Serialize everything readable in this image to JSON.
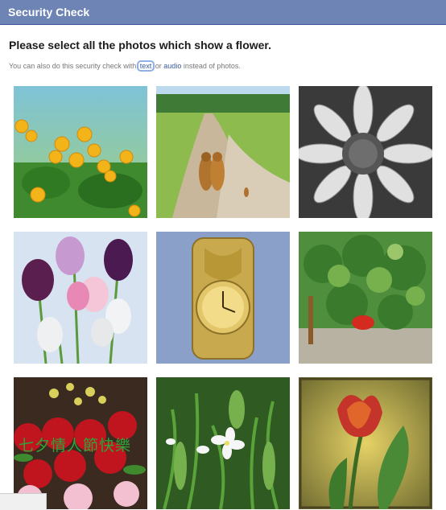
{
  "dialog": {
    "title": "Security Check",
    "heading": "Please select all the photos which show a flower.",
    "alt_prefix": "You can also do this security check with ",
    "text_link": "text",
    "alt_or": " or ",
    "audio_link": "audio",
    "alt_suffix": " instead of photos."
  },
  "photos": [
    {
      "subject": "yellow flowers",
      "icon": "photo-yellow-flowers"
    },
    {
      "subject": "dogs on dirt road",
      "icon": "photo-dogs-road"
    },
    {
      "subject": "black and white flower",
      "icon": "photo-bw-flower"
    },
    {
      "subject": "tulips",
      "icon": "photo-tulips"
    },
    {
      "subject": "gold pocket watch",
      "icon": "photo-pocket-watch"
    },
    {
      "subject": "tomato plant",
      "icon": "photo-tomato-plant"
    },
    {
      "subject": "rose bouquet",
      "icon": "photo-rose-bouquet",
      "overlay_text": "七夕情人節快樂"
    },
    {
      "subject": "white flowers with leaves",
      "icon": "photo-white-flowers"
    },
    {
      "subject": "tulip painting",
      "icon": "photo-tulip-painting"
    }
  ],
  "colors": {
    "titlebar": "#6d84b4",
    "link": "#3b5998"
  }
}
